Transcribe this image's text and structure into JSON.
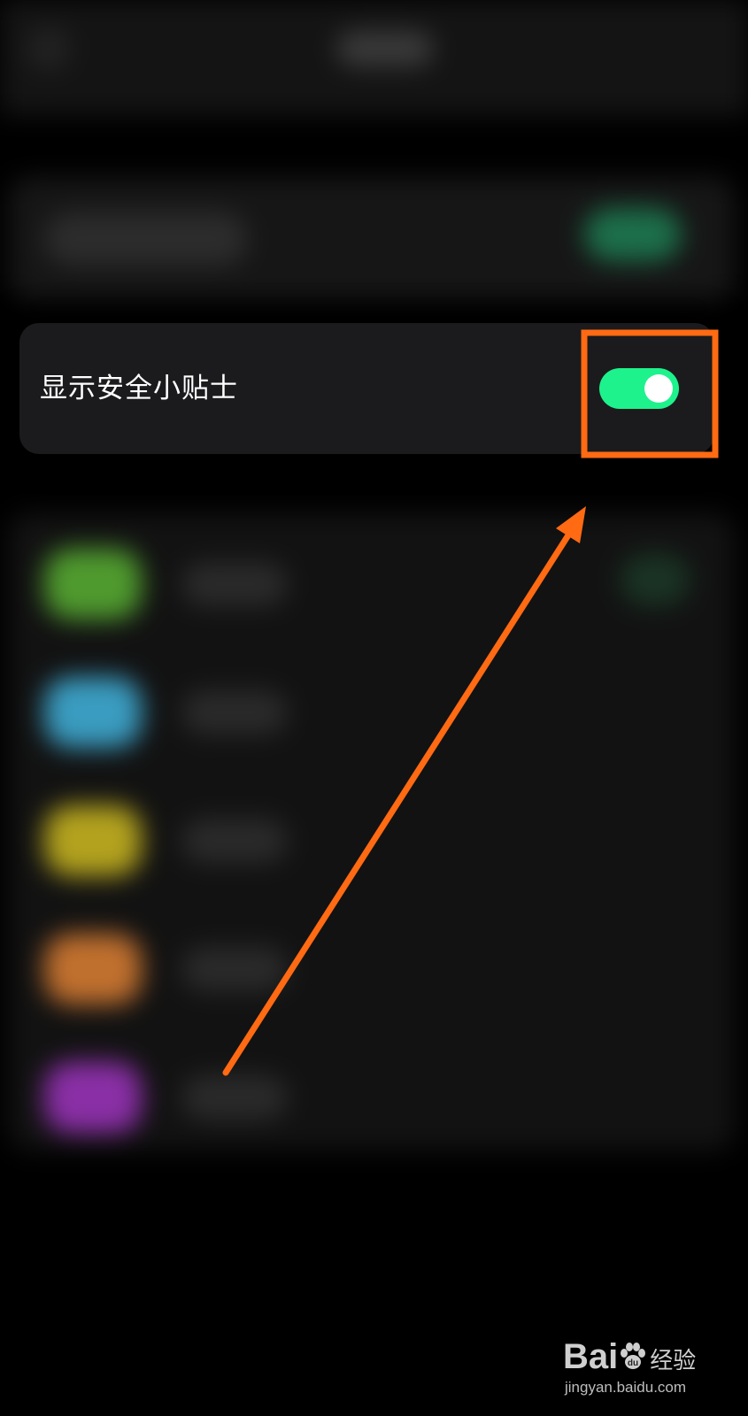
{
  "setting": {
    "label": "显示安全小贴士",
    "toggle_state": "on"
  },
  "colors": {
    "toggle_on": "#1ef28c",
    "card_background": "#1b1b1d",
    "highlight": "#ff6a13"
  },
  "blurred_rows": [
    {
      "icon_color": "#4f9a2e"
    },
    {
      "icon_color": "#3a9cc0"
    },
    {
      "icon_color": "#b3a21e"
    },
    {
      "icon_color": "#c0702e"
    },
    {
      "icon_color": "#8a2fa6"
    }
  ],
  "watermark": {
    "logo_left": "Bai",
    "logo_right": "经验",
    "url": "jingyan.baidu.com"
  }
}
